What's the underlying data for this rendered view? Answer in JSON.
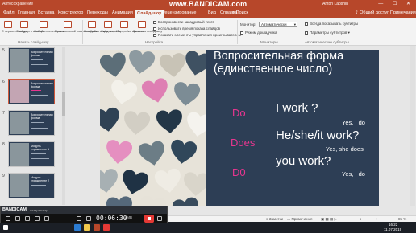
{
  "titlebar": {
    "quick_access": "Автосохранение",
    "watermark": "www.BANDICAM.com",
    "user": "Anton Lapshin",
    "window_buttons": "— ☐ ✕"
  },
  "tabs": {
    "items": [
      "Файл",
      "Главная",
      "Вставка",
      "Конструктор",
      "Переходы",
      "Анимация",
      "Слайд-шоу",
      "Рецензирование",
      "Вид",
      "Справка"
    ],
    "active": "Слайд-шоу",
    "search": "Поиск",
    "share": "Общий доступ",
    "comments": "Примечания"
  },
  "ribbon": {
    "buttons": {
      "from_start": "С первого слайда",
      "from_current": "С текущего слайда",
      "online": "Онлайн-презентация",
      "custom": "Произвольный показ слайдов",
      "setup": "Настройка слайд-шоу",
      "hide": "Скрыть слайд",
      "rehearse": "Настройка времени",
      "record": "Записать слайд-шоу"
    },
    "checks": {
      "narration": "Воспроизвести закадровый текст",
      "timings": "Использовать время показа слайдов",
      "media": "Показать элементы управления проигрывателем",
      "presenter": "Режим докладчика",
      "subtitles_always": "Всегда показывать субтитры",
      "subtitle_params": "Параметры субтитров"
    },
    "monitor_label": "Монитор:",
    "monitor_value": "Автоматически",
    "groups": {
      "start": "Начать слайд-шоу",
      "setup": "Настройка",
      "monitors": "Мониторы",
      "captions": "Автоматические субтитры"
    }
  },
  "thumbnails": [
    {
      "num": "5",
      "title": "Вопросительная форма (единственное число)"
    },
    {
      "num": "6",
      "title": "Вопросительная форма (единственное число)"
    },
    {
      "num": "7",
      "title": "Вопросительная форма"
    },
    {
      "num": "8",
      "title": "Модуль упражнение 1"
    },
    {
      "num": "9",
      "title": "Модуль упражнение 2"
    }
  ],
  "slide": {
    "title_line1": "Вопросительная форма",
    "title_line2": "(единственное число)",
    "rows": [
      {
        "aux": "Do",
        "question": "I work ?",
        "answer": "Yes, I do"
      },
      {
        "aux": "Does",
        "question": "He/she/it work?",
        "answer": "Yes, she does"
      },
      {
        "aux": "D0",
        "question": "you work?",
        "answer": "Yes, I do"
      }
    ]
  },
  "status": {
    "notes": "Заметки",
    "comments": "Примечания",
    "zoom": "85 %"
  },
  "bandicam": {
    "logo": "BANDICAM",
    "sub": "незарегистр.",
    "time": "00:06:30",
    "size": "5.1MB"
  },
  "taskbar": {
    "time": "16:22",
    "date": "11.07.2019"
  },
  "colors": {
    "accent": "#b7472a",
    "slide_bg": "#2d3e55",
    "aux_pink": "#e8368f"
  }
}
